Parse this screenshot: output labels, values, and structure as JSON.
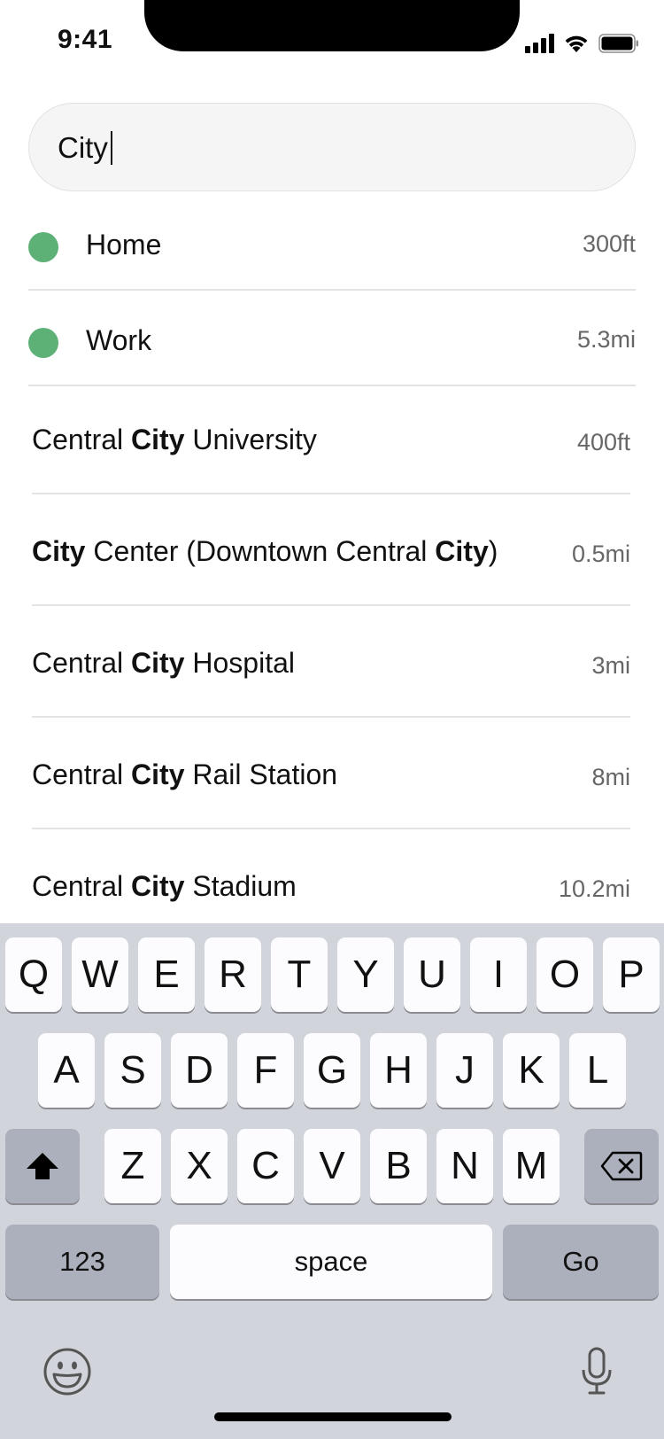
{
  "status_bar": {
    "time": "9:41"
  },
  "search": {
    "value": "City"
  },
  "saved_places": [
    {
      "label": "Home",
      "distance": "300ft",
      "color": "#5db076"
    },
    {
      "label": "Work",
      "distance": "5.3mi",
      "color": "#5db076"
    }
  ],
  "results": [
    {
      "parts": [
        {
          "text": "Central ",
          "bold": false
        },
        {
          "text": "City",
          "bold": true
        },
        {
          "text": " University",
          "bold": false
        }
      ],
      "distance": "400ft"
    },
    {
      "parts": [
        {
          "text": "City",
          "bold": true
        },
        {
          "text": " Center (Downtown Central ",
          "bold": false
        },
        {
          "text": "City",
          "bold": true
        },
        {
          "text": ")",
          "bold": false
        }
      ],
      "distance": "0.5mi"
    },
    {
      "parts": [
        {
          "text": "Central ",
          "bold": false
        },
        {
          "text": "City",
          "bold": true
        },
        {
          "text": " Hospital",
          "bold": false
        }
      ],
      "distance": "3mi"
    },
    {
      "parts": [
        {
          "text": "Central ",
          "bold": false
        },
        {
          "text": "City",
          "bold": true
        },
        {
          "text": " Rail Station",
          "bold": false
        }
      ],
      "distance": "8mi"
    },
    {
      "parts": [
        {
          "text": "Central ",
          "bold": false
        },
        {
          "text": "City",
          "bold": true
        },
        {
          "text": " Stadium",
          "bold": false
        }
      ],
      "distance": "10.2mi"
    }
  ],
  "keyboard": {
    "row1": [
      "Q",
      "W",
      "E",
      "R",
      "T",
      "Y",
      "U",
      "I",
      "O",
      "P"
    ],
    "row2": [
      "A",
      "S",
      "D",
      "F",
      "G",
      "H",
      "J",
      "K",
      "L"
    ],
    "row3": [
      "Z",
      "X",
      "C",
      "V",
      "B",
      "N",
      "M"
    ],
    "numbers_label": "123",
    "space_label": "space",
    "go_label": "Go",
    "icons": {
      "shift": "shift-icon",
      "delete": "delete-icon",
      "emoji": "emoji-icon",
      "mic": "microphone-icon"
    }
  }
}
